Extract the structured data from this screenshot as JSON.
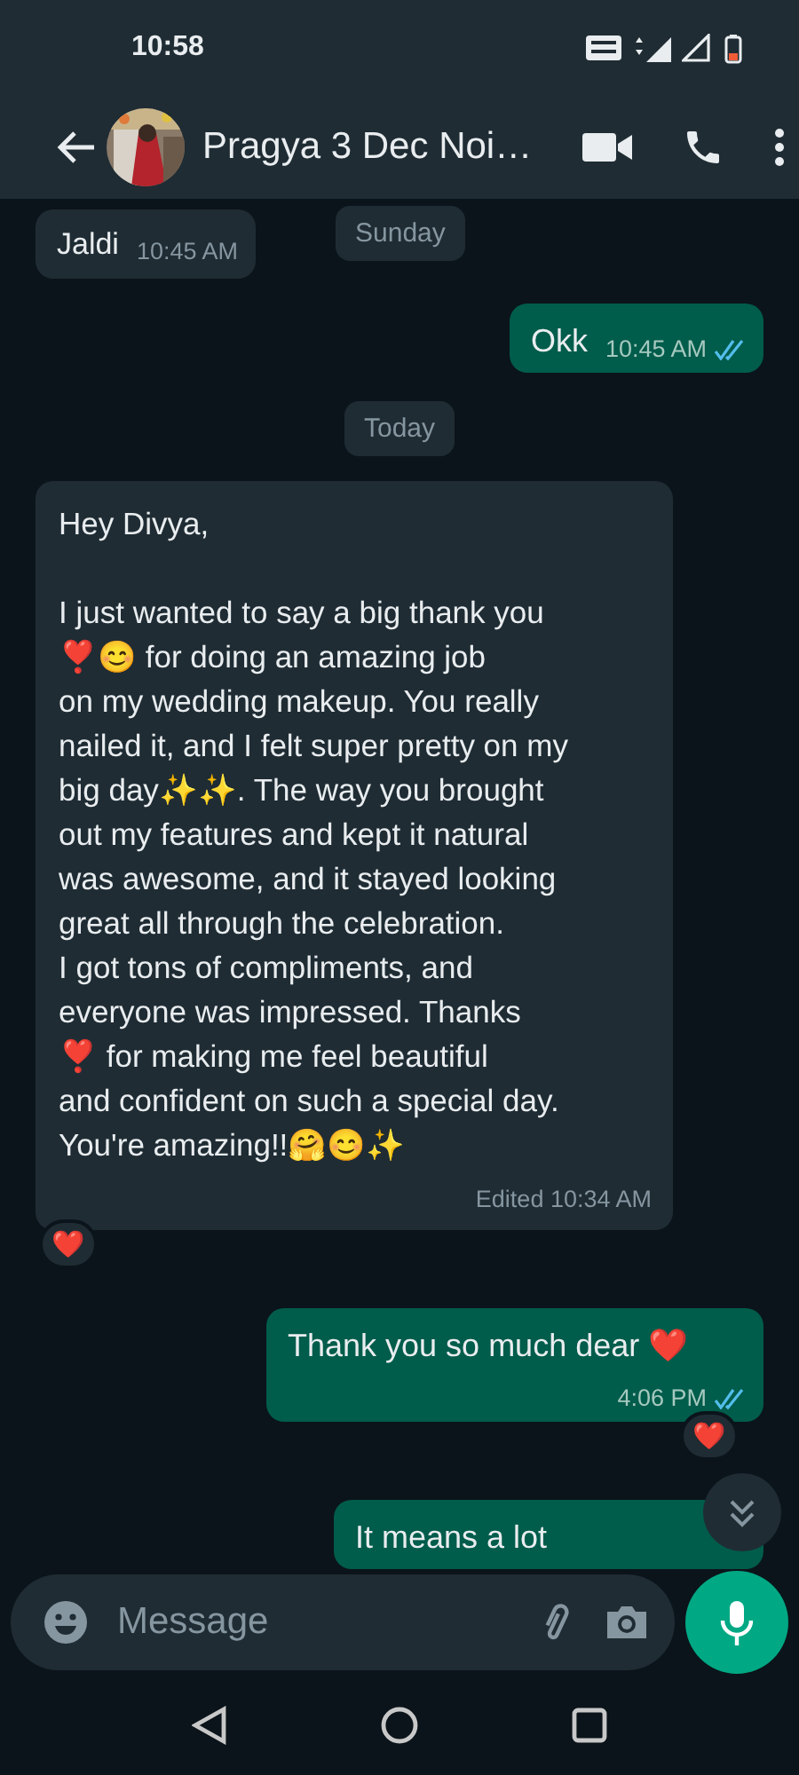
{
  "status_bar": {
    "time": "10:58"
  },
  "header": {
    "title": "Pragya 3 Dec Noi…"
  },
  "sticky_date": "Sunday",
  "messages": [
    {
      "kind": "message",
      "outgoing": false,
      "text": "Jaldi",
      "time": "10:45 AM"
    },
    {
      "kind": "message",
      "outgoing": true,
      "text": "Okk",
      "time": "10:45 AM",
      "read": true
    },
    {
      "kind": "date",
      "text": "Today"
    },
    {
      "kind": "message",
      "outgoing": false,
      "text": "Hey Divya,\n\nI just wanted to say a big thank you\n❣️😊 for doing an amazing job\non my wedding makeup. You really\nnailed it, and I felt super pretty on my\nbig day✨✨. The way you brought\nout my features and kept it natural\nwas awesome, and it stayed looking\ngreat all through the celebration.\nI got tons of compliments, and\neveryone was impressed. Thanks\n❣️ for making me feel beautiful\nand confident on such a special day.\nYou're amazing!!🤗😊✨",
      "edited_label": "Edited",
      "time": "10:34 AM",
      "reaction": "❤️"
    },
    {
      "kind": "message",
      "outgoing": true,
      "text": "Thank you so much dear ❤️",
      "time": "4:06 PM",
      "read": true,
      "reaction": "❤️"
    },
    {
      "kind": "message",
      "outgoing": true,
      "text": "It means a lot"
    }
  ],
  "composer": {
    "placeholder": "Message"
  }
}
